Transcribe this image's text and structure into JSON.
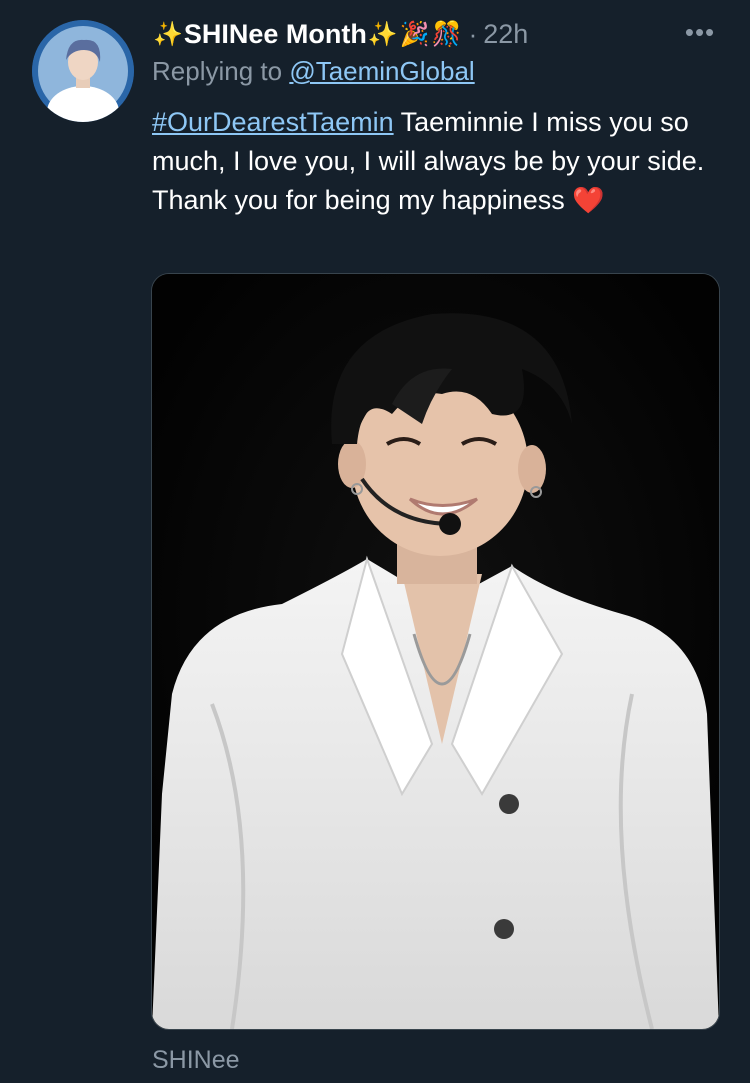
{
  "tweet": {
    "display_name": "SHINee Month",
    "name_emojis": {
      "leading": "✨",
      "trailing": "✨",
      "party": "🎉",
      "ribbon": "🎊"
    },
    "separator": "·",
    "timestamp": "22h",
    "more_label": "•••",
    "replying_prefix": "Replying to",
    "replying_handle": "@TaeminGlobal",
    "hashtag": "#OurDearestTaemin",
    "text": " Taeminnie I miss you so much, I love you, I will always be by your side.  Thank you for being my happiness ",
    "heart": "❤️",
    "footer_label": "SHINee"
  },
  "colors": {
    "background": "#15202b",
    "link": "#8ec7f5",
    "muted": "#8b98a5",
    "text": "#ffffff"
  },
  "icons": {
    "more": "more-dots-icon",
    "avatar": "profile-avatar"
  }
}
